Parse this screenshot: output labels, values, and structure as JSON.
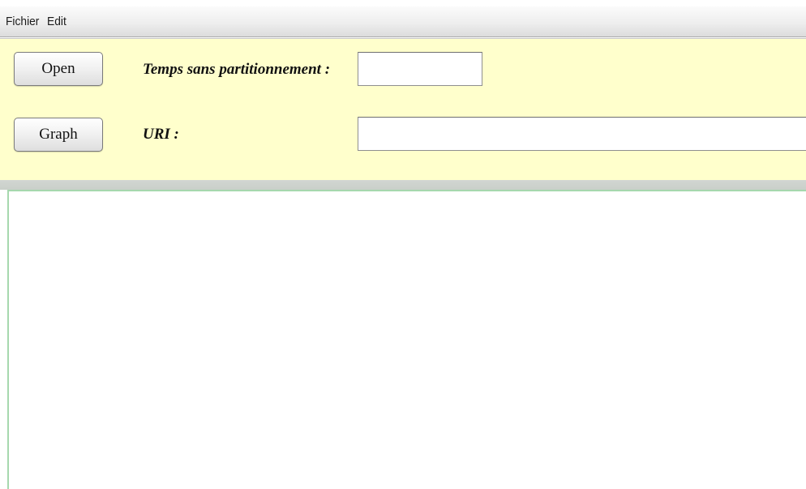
{
  "menubar": {
    "items": [
      {
        "label": "Fichier"
      },
      {
        "label": "Edit"
      }
    ]
  },
  "controls": {
    "open_button_label": "Open",
    "graph_button_label": "Graph",
    "temps_label": "Temps sans partitionnement :",
    "temps_value": "",
    "uri_label": "URI :",
    "uri_value": ""
  },
  "output": {
    "text": ""
  },
  "colors": {
    "panel_background": "#ffffcc",
    "output_border": "#a6d8ae"
  }
}
